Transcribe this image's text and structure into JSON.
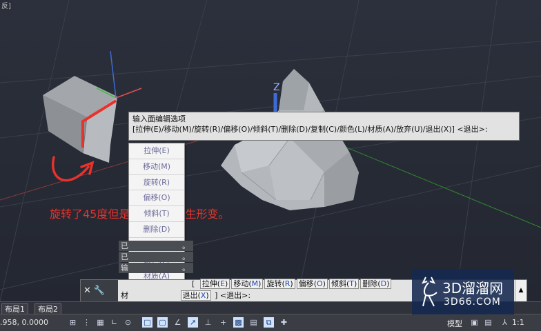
{
  "viewport": {
    "corner_label": "反]",
    "axis_z_label": "Z",
    "annotation_text": "旋转了45度但是立方体会发生形变。"
  },
  "tooltip": {
    "line1": "输入面编辑选项",
    "line2": "[拉伸(E)/移动(M)/旋转(R)/偏移(O)/倾斜(T)/删除(D)/复制(C)/颜色(L)/材质(A)/放弃(U)/退出(X)] <退出>:"
  },
  "menu": {
    "items": [
      {
        "label": "拉伸(E)"
      },
      {
        "label": "移动(M)"
      },
      {
        "label": "旋转(R)"
      },
      {
        "label": "偏移(O)"
      },
      {
        "label": "倾斜(T)"
      },
      {
        "label": "删除(D)"
      },
      {
        "label": "复制(C)"
      },
      {
        "label": "颜色(L)"
      },
      {
        "label": "材质(A)"
      },
      {
        "label": "放弃(U)"
      },
      {
        "label": "退出(X)",
        "selected": true
      }
    ]
  },
  "history": {
    "lines": [
      "已",
      "已",
      "输"
    ],
    "suffix": "。"
  },
  "command": {
    "prompt_prefix": "[",
    "options_row1": [
      {
        "word": "拉伸",
        "key": "E"
      },
      {
        "word": "移动",
        "key": "M"
      },
      {
        "word": "旋转",
        "key": "R"
      },
      {
        "word": "偏移",
        "key": "O"
      },
      {
        "word": "倾斜",
        "key": "T"
      },
      {
        "word": "删除",
        "key": "D"
      }
    ],
    "row2_prefix": "材",
    "row2_option": {
      "word": "退出",
      "key": "X"
    },
    "row2_suffix": "] <退出>:"
  },
  "tabs": [
    "布局1",
    "布局2"
  ],
  "status": {
    "coords": ".958, 0.0000",
    "model_label": "模型",
    "scale_label": "1:1"
  },
  "watermark": {
    "title": "3D溜溜网",
    "subtitle": "3D66.COM"
  },
  "colors": {
    "annotation": "#e8322b",
    "axis_x": "#e05050",
    "axis_y": "#3fbf3f",
    "axis_z": "#3d6bd8"
  }
}
